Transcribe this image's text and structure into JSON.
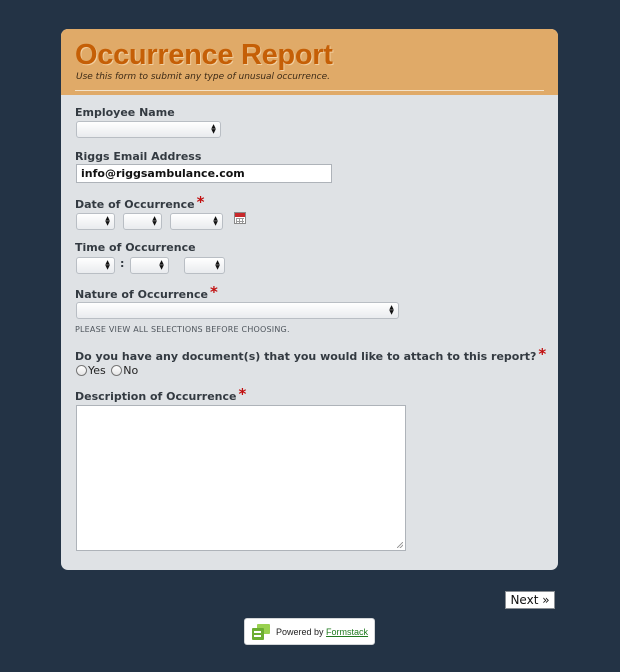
{
  "form": {
    "title": "Occurrence Report",
    "subtitle": "Use this form to submit any type of unusual occurrence.",
    "fields": {
      "employee_name": {
        "label": "Employee Name",
        "value": ""
      },
      "email": {
        "label": "Riggs Email Address",
        "value": "info@riggsambulance.com"
      },
      "date": {
        "label": "Date of Occurrence",
        "required_mark": "*",
        "month": "",
        "day": "",
        "year": ""
      },
      "time": {
        "label": "Time of Occurrence",
        "separator": ":",
        "hour": "",
        "minute": "",
        "ampm": ""
      },
      "nature": {
        "label": "Nature of Occurrence",
        "required_mark": "*",
        "value": "",
        "note": "PLEASE VIEW ALL SELECTIONS BEFORE CHOOSING."
      },
      "documents": {
        "label": "Do you have any document(s) that you would like to attach to this report?",
        "required_mark": "*",
        "options": [
          "Yes",
          "No"
        ],
        "selected": null
      },
      "description": {
        "label": "Description of Occurrence",
        "required_mark": "*",
        "value": ""
      }
    }
  },
  "navigation": {
    "next_label": "Next »"
  },
  "footer": {
    "powered_by": "Powered by",
    "brand": "Formstack"
  },
  "colors": {
    "background": "#233345",
    "card": "#dfe2e5",
    "header": "#e0aa68",
    "title": "#c55f06",
    "required": "#c10f0f"
  },
  "icons": {
    "calendar": "calendar-icon",
    "select_arrows": "updown-arrows-icon",
    "brand_logo": "formstack-logo-icon"
  }
}
